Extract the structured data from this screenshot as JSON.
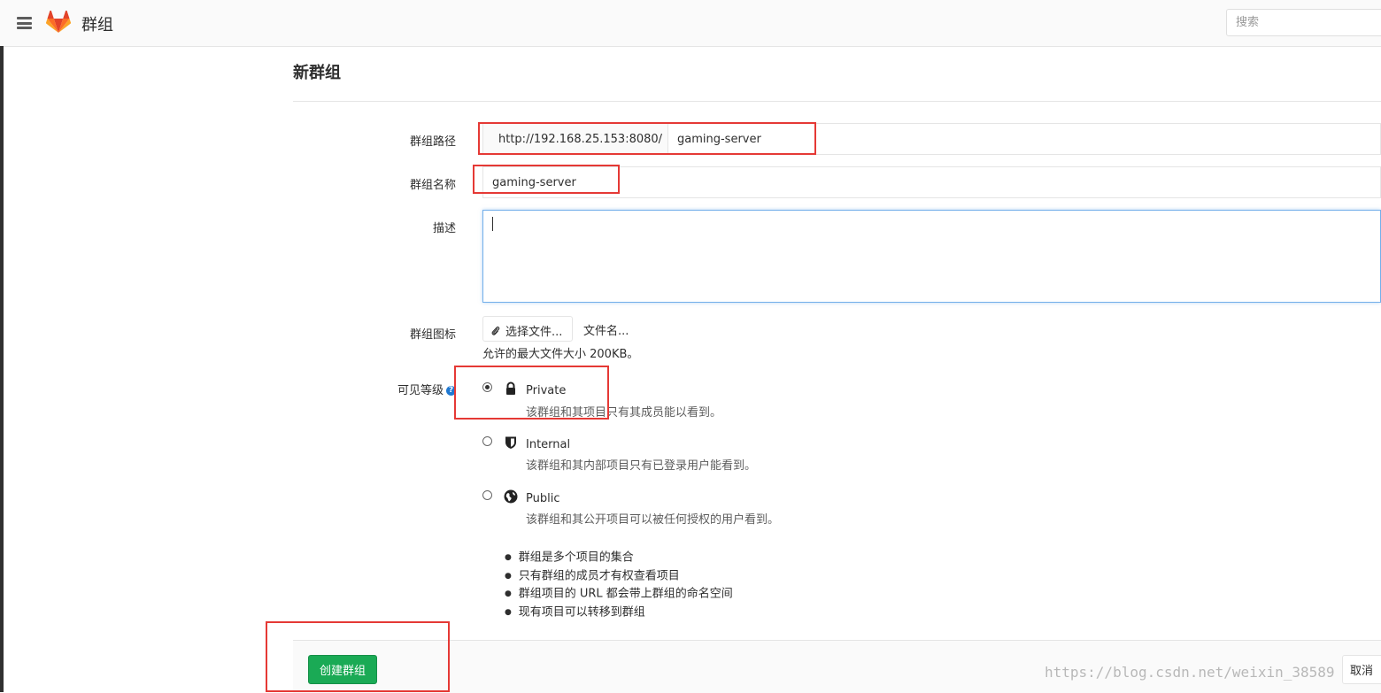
{
  "header": {
    "title": "群组",
    "search_placeholder": "搜索"
  },
  "page": {
    "title": "新群组"
  },
  "form": {
    "path_label": "群组路径",
    "path_prefix": "http://192.168.25.153:8080/",
    "path_value": "gaming-server",
    "name_label": "群组名称",
    "name_value": "gaming-server",
    "description_label": "描述",
    "avatar_label": "群组图标",
    "choose_file_label": "选择文件...",
    "file_name_placeholder": "文件名...",
    "max_size_hint": "允许的最大文件大小 200KB。",
    "visibility_label": "可见等级",
    "visibility_selected": "Private",
    "visibility_options": [
      {
        "title": "Private",
        "desc": "该群组和其项目只有其成员能以看到。",
        "icon": "lock-icon"
      },
      {
        "title": "Internal",
        "desc": "该群组和其内部项目只有已登录用户能看到。",
        "icon": "shield-icon"
      },
      {
        "title": "Public",
        "desc": "该群组和其公开项目可以被任何授权的用户看到。",
        "icon": "globe-icon"
      }
    ],
    "info_bullets": [
      "群组是多个项目的集合",
      "只有群组的成员才有权查看项目",
      "群组项目的 URL 都会带上群组的命名空间",
      "现有项目可以转移到群组"
    ]
  },
  "actions": {
    "create_label": "创建群组",
    "cancel_label": "取消"
  },
  "watermark": "https://blog.csdn.net/weixin_38589",
  "colors": {
    "primary_green": "#1aaa55",
    "annotation_red": "#e53935",
    "focus_blue": "#73afea",
    "help_blue": "#1f78d1"
  }
}
